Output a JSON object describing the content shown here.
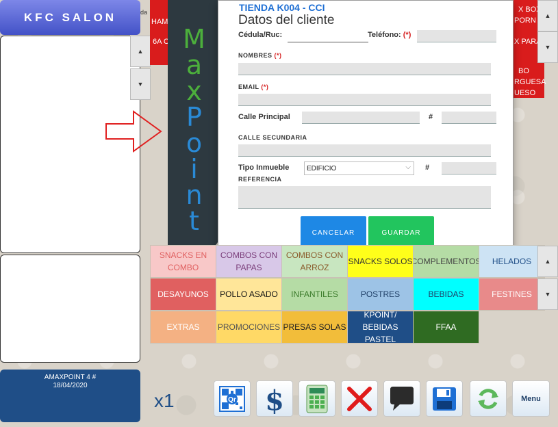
{
  "left_panel": {
    "title": "KFC SALON",
    "footer_line1": "AMAXPOINT 4 #",
    "footer_line2": "18/04/2020"
  },
  "background_products": {
    "left_partial": [
      "HAM",
      "6A C"
    ],
    "left_edge_text": "da",
    "right_partial": [
      "X BOX",
      "PORN",
      "X PARA",
      "BO",
      "RGUESA",
      "UESO"
    ]
  },
  "banner": {
    "letters": [
      "M",
      "a",
      "x",
      "P",
      "o",
      "i",
      "n",
      "t"
    ],
    "colors": [
      "#4caf3c",
      "#4caf3c",
      "#4caf3c",
      "#2a8ad6",
      "#2a8ad6",
      "#2a8ad6",
      "#2a8ad6",
      "#2a8ad6"
    ]
  },
  "modal": {
    "store": "TIENDA K004 - CCI",
    "title": "Datos del cliente",
    "cedula_label": "Cédula/Ruc:",
    "telefono_label": "Teléfono:",
    "required_mark": "(*)",
    "nombres_label": "NOMBRES",
    "email_label": "EMAIL",
    "calle_principal_label": "Calle Principal",
    "hash_label": "#",
    "calle_secundaria_label": "CALLE SECUNDARIA",
    "tipo_inmueble_label": "Tipo Inmueble",
    "tipo_inmueble_value": "EDIFICIO",
    "referencia_label": "REFERENCIA",
    "cancel_label": "CANCELAR",
    "save_label": "GUARDAR",
    "cancel_color": "#1e88e5",
    "save_color": "#22c55e"
  },
  "categories": [
    [
      {
        "label": "SNACKS EN COMBO",
        "bg": "#f8c8c8",
        "fg": "#e06060"
      },
      {
        "label": "COMBOS CON PAPAS",
        "bg": "#d8c8e8",
        "fg": "#7a3d7a"
      },
      {
        "label": "COMBOS CON ARROZ",
        "bg": "#c8e6c0",
        "fg": "#8a5a2a"
      },
      {
        "label": "SNACKS SOLOS",
        "bg": "#ffff1a",
        "fg": "#333333"
      },
      {
        "label": "COMPLEMENTOS",
        "bg": "#b5dca5",
        "fg": "#444444"
      },
      {
        "label": "HELADOS",
        "bg": "#cde3f4",
        "fg": "#1f4e87"
      }
    ],
    [
      {
        "label": "DESAYUNOS",
        "bg": "#e06060",
        "fg": "#ffffff"
      },
      {
        "label": "POLLO ASADO",
        "bg": "#ffe699",
        "fg": "#111111"
      },
      {
        "label": "INFANTILES",
        "bg": "#b5dca5",
        "fg": "#3a7a2a"
      },
      {
        "label": "POSTRES",
        "bg": "#9dc3e6",
        "fg": "#1f3f67"
      },
      {
        "label": "BEBIDAS",
        "bg": "#00ffff",
        "fg": "#1f3f67"
      },
      {
        "label": "FESTINES",
        "bg": "#e88a8a",
        "fg": "#ffffff"
      }
    ],
    [
      {
        "label": "EXTRAS",
        "bg": "#f4b183",
        "fg": "#ffffff"
      },
      {
        "label": "PROMOCIONES",
        "bg": "#ffd966",
        "fg": "#555555"
      },
      {
        "label": "PRESAS SOLAS",
        "bg": "#f2bd3a",
        "fg": "#222222"
      },
      {
        "label": "KPOINT/ BEBIDAS PASTEL",
        "bg": "#1f4e87",
        "fg": "#ffffff"
      },
      {
        "label": "FFAA",
        "bg": "#2f6b22",
        "fg": "#ffffff"
      }
    ]
  ],
  "toolbar": {
    "multiplier": "x1",
    "menu_label": "Menu",
    "tools": [
      "qr-icon",
      "dollar-icon",
      "calculator-icon",
      "cancel-x-icon",
      "chat-bubble-icon",
      "save-disk-icon",
      "refresh-icon"
    ]
  }
}
